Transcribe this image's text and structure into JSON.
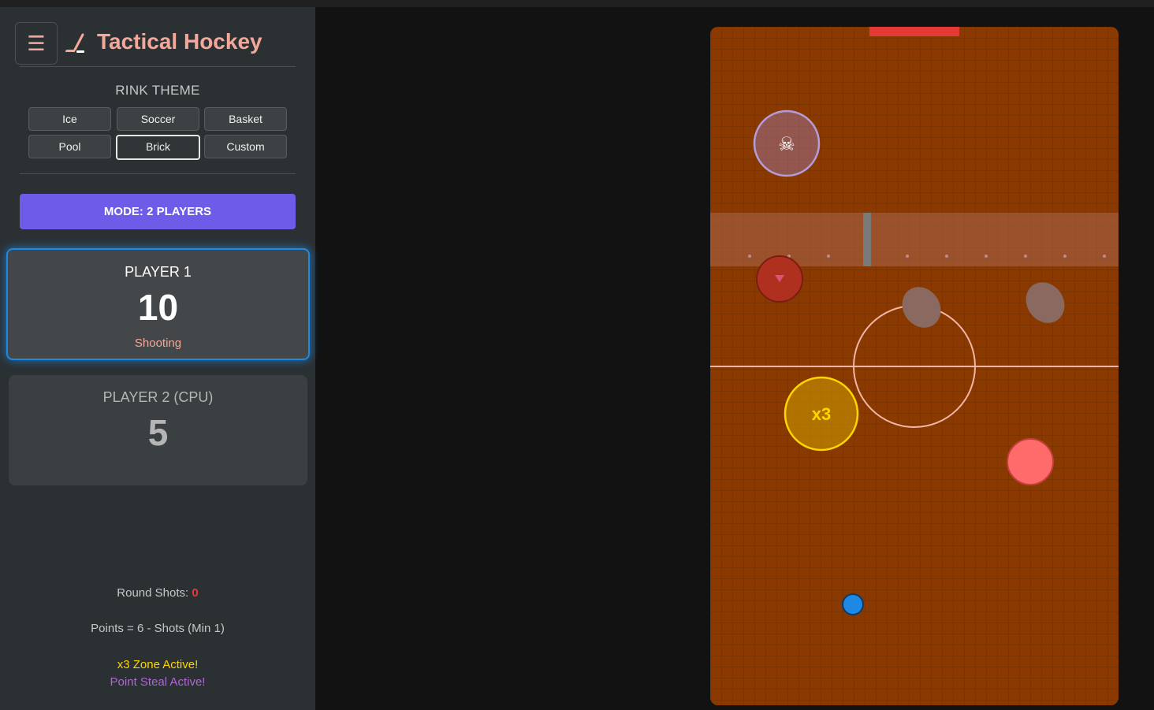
{
  "app": {
    "title": "Tactical Hockey",
    "menu_icon": "hamburger-icon",
    "logo_icon": "hockey-stick-icon"
  },
  "rink_theme": {
    "label": "RINK THEME",
    "options": [
      "Ice",
      "Soccer",
      "Basket",
      "Pool",
      "Brick",
      "Custom"
    ],
    "selected": "Brick"
  },
  "mode": {
    "label": "MODE: 2 PLAYERS"
  },
  "players": [
    {
      "name": "PLAYER 1",
      "score": "10",
      "status": "Shooting",
      "active": true
    },
    {
      "name": "PLAYER 2 (CPU)",
      "score": "5",
      "status": "",
      "active": false
    }
  ],
  "info": {
    "round_shots_label": "Round Shots:",
    "round_shots_value": "0",
    "points_rule": "Points = 6 - Shots (Min 1)",
    "zone_active": "x3 Zone Active!",
    "steal_active": "Point Steal Active!"
  },
  "rink": {
    "theme": "Brick",
    "multiplier_label": "x3",
    "steal_icon": "skull-crossbones-icon",
    "colors": {
      "surface": "#8a3a00",
      "goal": "#e53935",
      "center_line": "#f4b5a8",
      "multiplier": "#ffd600",
      "steal": "#b39ddb",
      "target": "#ff6b6b",
      "player_puck": "#1e88e5"
    }
  }
}
